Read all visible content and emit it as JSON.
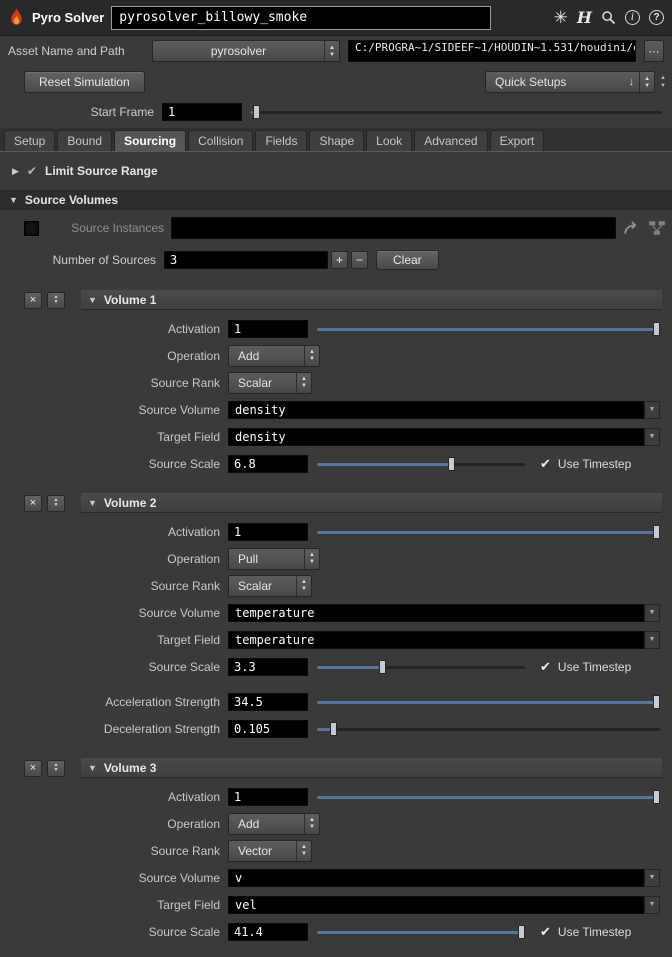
{
  "titlebar": {
    "app_label": "Pyro Solver",
    "node_name": "pyrosolver_billowy_smoke"
  },
  "asset_row": {
    "label": "Asset Name and Path",
    "asset": "pyrosolver",
    "path": "C:/PROGRA~1/SIDEEF~1/HOUDIN~1.531/houdini/o..."
  },
  "actions": {
    "reset": "Reset Simulation",
    "quick_setups": "Quick Setups"
  },
  "start_frame": {
    "label": "Start Frame",
    "value": "1",
    "slider": 0.004
  },
  "tabs": [
    {
      "label": "Setup",
      "active": false
    },
    {
      "label": "Bound",
      "active": false
    },
    {
      "label": "Sourcing",
      "active": true
    },
    {
      "label": "Collision",
      "active": false
    },
    {
      "label": "Fields",
      "active": false
    },
    {
      "label": "Shape",
      "active": false
    },
    {
      "label": "Look",
      "active": false
    },
    {
      "label": "Advanced",
      "active": false
    },
    {
      "label": "Export",
      "active": false
    }
  ],
  "limit_source_range": {
    "label": "Limit Source Range"
  },
  "source_volumes_section": {
    "label": "Source Volumes"
  },
  "source_instances": {
    "label": "Source Instances",
    "value": ""
  },
  "number_of_sources": {
    "label": "Number of Sources",
    "value": "3",
    "clear": "Clear"
  },
  "use_timestep_label": "Use Timestep",
  "volumes": [
    {
      "title": "Volume 1",
      "activation": {
        "label": "Activation",
        "value": "1",
        "slider": 1
      },
      "operation": {
        "label": "Operation",
        "value": "Add"
      },
      "source_rank": {
        "label": "Source Rank",
        "value": "Scalar"
      },
      "source_volume": {
        "label": "Source Volume",
        "value": "density"
      },
      "target_field": {
        "label": "Target Field",
        "value": "density"
      },
      "source_scale": {
        "label": "Source Scale",
        "value": "6.8",
        "slider": 0.65,
        "use_timestep": true
      }
    },
    {
      "title": "Volume 2",
      "activation": {
        "label": "Activation",
        "value": "1",
        "slider": 1
      },
      "operation": {
        "label": "Operation",
        "value": "Pull"
      },
      "source_rank": {
        "label": "Source Rank",
        "value": "Scalar"
      },
      "source_volume": {
        "label": "Source Volume",
        "value": "temperature"
      },
      "target_field": {
        "label": "Target Field",
        "value": "temperature"
      },
      "source_scale": {
        "label": "Source Scale",
        "value": "3.3",
        "slider": 0.31,
        "use_timestep": true
      },
      "acceleration_strength": {
        "label": "Acceleration Strength",
        "value": "34.5",
        "slider": 1
      },
      "deceleration_strength": {
        "label": "Deceleration Strength",
        "value": "0.105",
        "slider": 0.04
      }
    },
    {
      "title": "Volume 3",
      "activation": {
        "label": "Activation",
        "value": "1",
        "slider": 1
      },
      "operation": {
        "label": "Operation",
        "value": "Add"
      },
      "source_rank": {
        "label": "Source Rank",
        "value": "Vector"
      },
      "source_volume": {
        "label": "Source Volume",
        "value": "v"
      },
      "target_field": {
        "label": "Target Field",
        "value": "vel"
      },
      "source_scale": {
        "label": "Source Scale",
        "value": "41.4",
        "slider": 1,
        "use_timestep": true
      }
    }
  ],
  "icons": {
    "burst": "✳",
    "logo": "H",
    "info": "i",
    "help": "?",
    "more": "⋯",
    "up": "▲",
    "down": "▼",
    "tri_right": "▶",
    "tri_down": "▼",
    "menu_down": "↓",
    "delete": "×",
    "check": "✔",
    "plus": "+",
    "minus": "−"
  }
}
